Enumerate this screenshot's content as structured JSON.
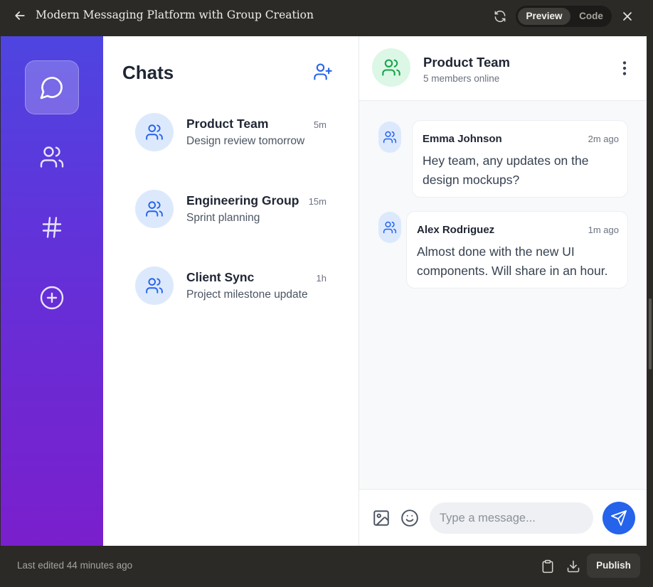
{
  "window": {
    "title": "Modern Messaging Platform with Group Creation",
    "tabs": [
      "Preview",
      "Code"
    ],
    "active_tab": "Preview",
    "last_edited": "Last edited 44 minutes ago",
    "publish_label": "Publish"
  },
  "rail": {
    "items": [
      {
        "icon": "message-icon",
        "active": true
      },
      {
        "icon": "users-icon",
        "active": false
      },
      {
        "icon": "hash-icon",
        "active": false
      },
      {
        "icon": "plus-circle-icon",
        "active": false
      }
    ]
  },
  "chats": {
    "heading": "Chats",
    "items": [
      {
        "name": "Product Team",
        "preview": "Design review tomorrow",
        "time": "5m"
      },
      {
        "name": "Engineering Group",
        "preview": "Sprint planning",
        "time": "15m"
      },
      {
        "name": "Client Sync",
        "preview": "Project milestone update",
        "time": "1h"
      }
    ]
  },
  "conversation": {
    "name": "Product Team",
    "status": "5 members online",
    "messages": [
      {
        "sender": "Emma Johnson",
        "time": "2m ago",
        "text": "Hey team, any updates on the design mockups?"
      },
      {
        "sender": "Alex Rodriguez",
        "time": "1m ago",
        "text": "Almost done with the new UI components. Will share in an hour."
      }
    ],
    "composer_placeholder": "Type a message..."
  },
  "colors": {
    "accent": "#2563eb",
    "rail_top": "#4e45e1",
    "rail_bottom": "#7a1fcc",
    "group_avatar_bg": "#dcf7e5",
    "chat_avatar_bg": "#dce9fd"
  }
}
